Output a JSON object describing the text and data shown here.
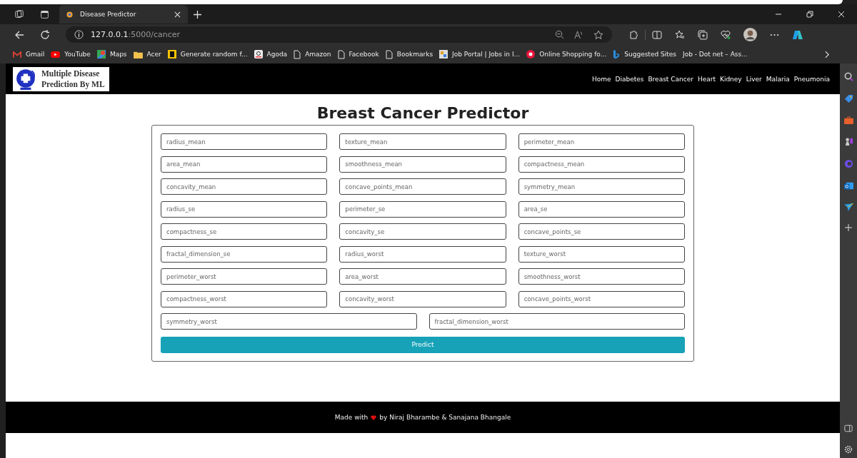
{
  "browser": {
    "tab": {
      "title": "Disease Predictor",
      "selected": true
    },
    "address": {
      "host": "127.0.0.1",
      "path": ":5000/cancer"
    },
    "bookmarks": [
      {
        "label": "Gmail",
        "kind": "gmail"
      },
      {
        "label": "YouTube",
        "kind": "youtube"
      },
      {
        "label": "Maps",
        "kind": "maps"
      },
      {
        "label": "Acer",
        "kind": "folder"
      },
      {
        "label": "Generate random f...",
        "kind": "letter"
      },
      {
        "label": "Agoda",
        "kind": "agoda"
      },
      {
        "label": "Amazon",
        "kind": "page"
      },
      {
        "label": "Facebook",
        "kind": "page"
      },
      {
        "label": "Bookmarks",
        "kind": "page"
      },
      {
        "label": "Job Portal | Jobs in I...",
        "kind": "tile"
      },
      {
        "label": "Online Shopping fo...",
        "kind": "shop"
      },
      {
        "label": "Suggested Sites",
        "kind": "bing"
      },
      {
        "label": "Job - Dot net – Ass...",
        "kind": "text"
      }
    ]
  },
  "navbar": {
    "logo_lines": [
      "Multiple Disease",
      "Prediction By ML"
    ],
    "links": [
      {
        "label": "Home"
      },
      {
        "label": "Diabetes"
      },
      {
        "label": "Breast Cancer"
      },
      {
        "label": "Heart"
      },
      {
        "label": "Kidney"
      },
      {
        "label": "Liver"
      },
      {
        "label": "Malaria"
      },
      {
        "label": "Pneumonia"
      }
    ]
  },
  "title": "Breast Cancer Predictor",
  "form": {
    "rows": [
      {
        "fields": [
          {
            "placeholder": "radius_mean"
          },
          {
            "placeholder": "texture_mean"
          },
          {
            "placeholder": "perimeter_mean"
          }
        ]
      },
      {
        "fields": [
          {
            "placeholder": "area_mean"
          },
          {
            "placeholder": "smoothness_mean"
          },
          {
            "placeholder": "compactness_mean"
          }
        ]
      },
      {
        "fields": [
          {
            "placeholder": "concavity_mean"
          },
          {
            "placeholder": "concave_points_mean"
          },
          {
            "placeholder": "symmetry_mean"
          }
        ]
      },
      {
        "fields": [
          {
            "placeholder": "radius_se"
          },
          {
            "placeholder": "perimeter_se"
          },
          {
            "placeholder": "area_se"
          }
        ]
      },
      {
        "fields": [
          {
            "placeholder": "compactness_se"
          },
          {
            "placeholder": "concavity_se"
          },
          {
            "placeholder": "concave_points_se"
          }
        ]
      },
      {
        "fields": [
          {
            "placeholder": "fractal_dimension_se"
          },
          {
            "placeholder": "radius_worst"
          },
          {
            "placeholder": "texture_worst"
          }
        ]
      },
      {
        "fields": [
          {
            "placeholder": "perimeter_worst"
          },
          {
            "placeholder": "area_worst"
          },
          {
            "placeholder": "smoothness_worst"
          }
        ]
      },
      {
        "fields": [
          {
            "placeholder": "compactness_worst"
          },
          {
            "placeholder": "concavity_worst"
          },
          {
            "placeholder": "concave_points_worst"
          }
        ]
      },
      {
        "fields": [
          {
            "placeholder": "symmetry_worst"
          },
          {
            "placeholder": "fractal_dimension_worst"
          }
        ]
      }
    ],
    "button": "Predict"
  },
  "footer": {
    "before": "Made with",
    "after": "by Niraj Bharambe & Sanajana Bhangale"
  }
}
